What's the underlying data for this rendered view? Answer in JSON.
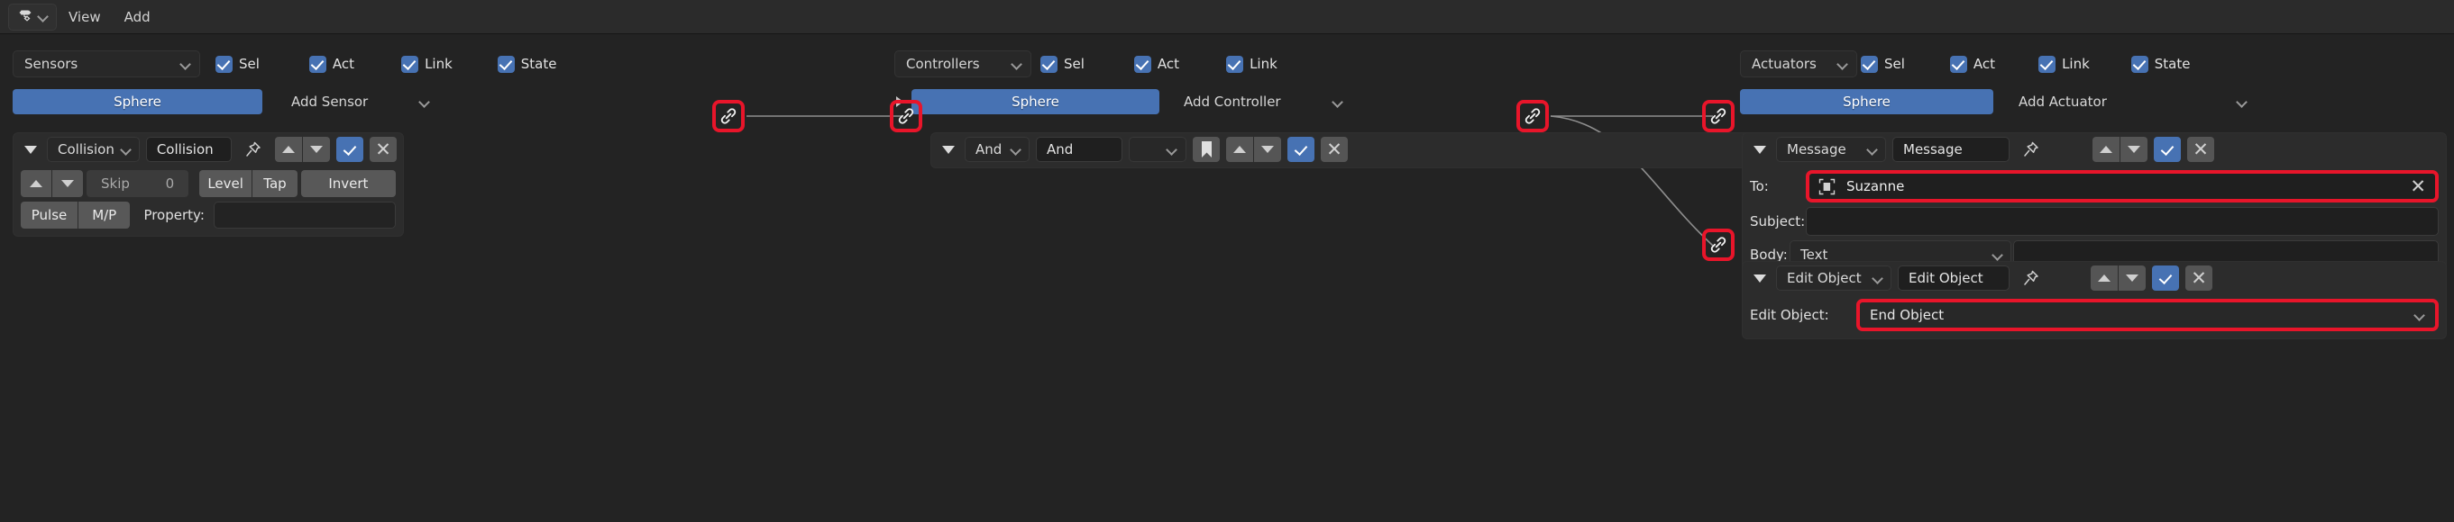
{
  "app": {
    "editor": "logic-editor"
  },
  "topbar": {
    "editor_type_icon": "logic-editor-icon",
    "menus": [
      {
        "label": "View",
        "name": "menu-view"
      },
      {
        "label": "Add",
        "name": "menu-add"
      }
    ]
  },
  "sensors": {
    "type_label": "Sensors",
    "filters": [
      {
        "label": "Sel",
        "checked": true
      },
      {
        "label": "Act",
        "checked": true
      },
      {
        "label": "Link",
        "checked": true
      },
      {
        "label": "State",
        "checked": true
      }
    ],
    "object_name": "Sphere",
    "add_label": "Add Sensor",
    "brick": {
      "type": "Collision",
      "name": "Collision",
      "skip_label": "Skip",
      "skip_value": "0",
      "level_label": "Level",
      "tap_label": "Tap",
      "invert_label": "Invert",
      "pulse_label": "Pulse",
      "mp_label": "M/P",
      "property_label": "Property:",
      "property_value": ""
    }
  },
  "controllers": {
    "type_label": "Controllers",
    "filters": [
      {
        "label": "Sel",
        "checked": true
      },
      {
        "label": "Act",
        "checked": true
      },
      {
        "label": "Link",
        "checked": true
      }
    ],
    "object_name": "Sphere",
    "add_label": "Add Controller",
    "brick": {
      "type": "And",
      "name": "And"
    }
  },
  "actuators": {
    "type_label": "Actuators",
    "filters": [
      {
        "label": "Sel",
        "checked": true
      },
      {
        "label": "Act",
        "checked": true
      },
      {
        "label": "Link",
        "checked": true
      },
      {
        "label": "State",
        "checked": true
      }
    ],
    "object_name": "Sphere",
    "add_label": "Add Actuator",
    "message_brick": {
      "type": "Message",
      "name": "Message",
      "to_label": "To:",
      "to_value": "Suzanne",
      "subject_label": "Subject:",
      "subject_value": "",
      "body_label": "Body:",
      "body_mode": "Text",
      "body_value": ""
    },
    "edit_object_brick": {
      "type": "Edit Object",
      "name": "Edit Object",
      "field_label": "Edit Object:",
      "field_value": "End Object"
    }
  },
  "colors": {
    "accent_blue": "#4772b3",
    "highlight_red": "#e8152a",
    "panel_bg": "#2c2c2c",
    "canvas_bg": "#232323",
    "topbar_bg": "#2b2b2b"
  }
}
